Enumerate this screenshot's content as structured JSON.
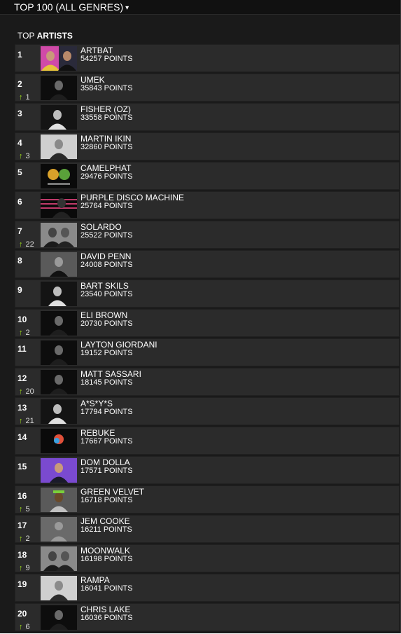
{
  "header": {
    "title": "TOP 100 (ALL GENRES)",
    "caret": "▾"
  },
  "section": {
    "prefix": "TOP",
    "title": "ARTISTS"
  },
  "points_suffix": "POINTS",
  "colors": {
    "background": "#1a1a1a",
    "row": "#2b2b2b",
    "up_arrow": "#9fe01b"
  },
  "artists": [
    {
      "rank": "1",
      "name": "ARTBAT",
      "points": "54257 POINTS",
      "move": "",
      "photo": "pink-duo"
    },
    {
      "rank": "2",
      "name": "UMEK",
      "points": "35843 POINTS",
      "move": "1",
      "photo": "dark-portrait"
    },
    {
      "rank": "3",
      "name": "FISHER (OZ)",
      "points": "33558 POINTS",
      "move": "",
      "photo": "mono-figure"
    },
    {
      "rank": "4",
      "name": "MARTIN IKIN",
      "points": "32860 POINTS",
      "move": "3",
      "photo": "light-portrait"
    },
    {
      "rank": "5",
      "name": "CAMELPHAT",
      "points": "29476 POINTS",
      "move": "",
      "photo": "masks"
    },
    {
      "rank": "6",
      "name": "PURPLE DISCO MACHINE",
      "points": "25764 POINTS",
      "move": "",
      "photo": "stage-lines"
    },
    {
      "rank": "7",
      "name": "SOLARDO",
      "points": "25522 POINTS",
      "move": "22",
      "photo": "grey-duo"
    },
    {
      "rank": "8",
      "name": "DAVID PENN",
      "points": "24008 POINTS",
      "move": "",
      "photo": "grey-portrait"
    },
    {
      "rank": "9",
      "name": "BART SKILS",
      "points": "23540 POINTS",
      "move": "",
      "photo": "mono-figure"
    },
    {
      "rank": "10",
      "name": "ELI BROWN",
      "points": "20730 POINTS",
      "move": "2",
      "photo": "dark-portrait"
    },
    {
      "rank": "11",
      "name": "LAYTON GIORDANI",
      "points": "19152 POINTS",
      "move": "",
      "photo": "dark-portrait"
    },
    {
      "rank": "12",
      "name": "MATT SASSARI",
      "points": "18145 POINTS",
      "move": "20",
      "photo": "dark-portrait"
    },
    {
      "rank": "13",
      "name": "A*S*Y*S",
      "points": "17794 POINTS",
      "move": "21",
      "photo": "mono-figure"
    },
    {
      "rank": "14",
      "name": "REBUKE",
      "points": "17667 POINTS",
      "move": "",
      "photo": "color-shape"
    },
    {
      "rank": "15",
      "name": "DOM DOLLA",
      "points": "17571 POINTS",
      "move": "",
      "photo": "purple-portrait"
    },
    {
      "rank": "16",
      "name": "GREEN VELVET",
      "points": "16718 POINTS",
      "move": "5",
      "photo": "green-portrait"
    },
    {
      "rank": "17",
      "name": "JEM COOKE",
      "points": "16211 POINTS",
      "move": "2",
      "photo": "placeholder-avatar"
    },
    {
      "rank": "18",
      "name": "MOONWALK",
      "points": "16198 POINTS",
      "move": "9",
      "photo": "grey-duo"
    },
    {
      "rank": "19",
      "name": "RAMPA",
      "points": "16041 POINTS",
      "move": "",
      "photo": "light-portrait"
    },
    {
      "rank": "20",
      "name": "CHRIS LAKE",
      "points": "16036 POINTS",
      "move": "6",
      "photo": "dark-portrait"
    }
  ]
}
